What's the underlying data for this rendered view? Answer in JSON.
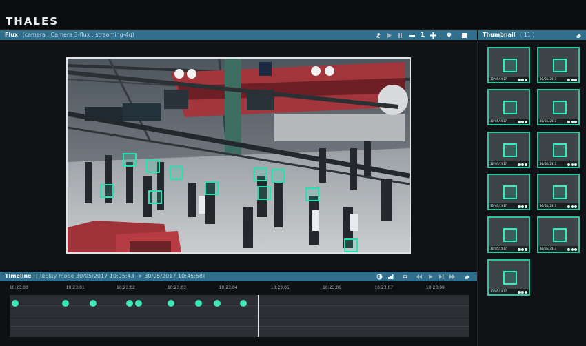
{
  "brand": {
    "name": "THALES"
  },
  "flux": {
    "title": "Flux",
    "subtitle": "(camera : Camera 3-flux : streaming-4q)",
    "icons": [
      "camera-icon",
      "play-icon",
      "pause-icon",
      "zoom-out-icon",
      "zoom-level",
      "zoom-in-icon",
      "location-pin-icon",
      "stop-icon"
    ],
    "zoom_value": "1"
  },
  "thumbnail": {
    "title": "Thumbnail",
    "count": "( 11 )",
    "items": [
      {
        "label": "30/05/2017"
      },
      {
        "label": "30/05/2017"
      },
      {
        "label": "30/05/2017"
      },
      {
        "label": "30/05/2017"
      },
      {
        "label": "30/05/2017"
      },
      {
        "label": "30/05/2017"
      },
      {
        "label": "30/05/2017"
      },
      {
        "label": "30/05/2017"
      },
      {
        "label": "30/05/2017"
      },
      {
        "label": "30/05/2017"
      },
      {
        "label": "30/05/2017"
      }
    ]
  },
  "timeline": {
    "title": "Timeline",
    "subtitle": "[Replay mode 30/05/2017 10:05:43 -> 30/05/2017 10:45:58]",
    "ticks": [
      "10:23:00",
      "10:23:01",
      "10:23:02",
      "10:23:03",
      "10:23:04",
      "10:23:05",
      "10:23:06",
      "10:23:07",
      "10:23:08"
    ],
    "event_positions_pct": [
      1.2,
      12.1,
      18.1,
      26.1,
      28.1,
      35.1,
      41.2,
      45.2,
      50.9
    ],
    "cursor_pct": 54.0
  },
  "colors": {
    "accent": "#2f6f8c",
    "detection": "#29e0b4",
    "event": "#3ee6b8"
  }
}
